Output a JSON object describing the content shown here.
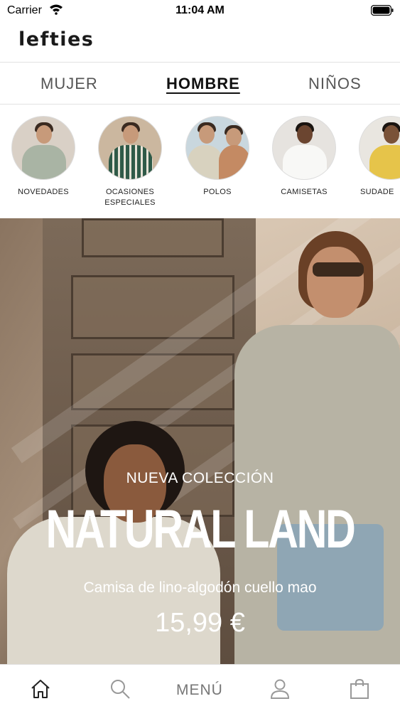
{
  "status_bar": {
    "carrier": "Carrier",
    "time": "11:04 AM"
  },
  "header": {
    "logo": "lefties"
  },
  "tabs": [
    {
      "label": "MUJER",
      "active": false
    },
    {
      "label": "HOMBRE",
      "active": true
    },
    {
      "label": "NIÑOS",
      "active": false
    }
  ],
  "categories": [
    {
      "label": "NOVEDADES",
      "shirt_color": "#a9b4a4"
    },
    {
      "label": "OCASIONES ESPECIALES",
      "shirt_color": "#2f5a48"
    },
    {
      "label": "POLOS",
      "shirt_color": "#d8d2bf"
    },
    {
      "label": "CAMISETAS",
      "shirt_color": "#f2f1ee"
    },
    {
      "label": "SUDADE",
      "shirt_color": "#e6c44a"
    }
  ],
  "hero": {
    "overline": "NUEVA COLECCIÓN",
    "title": "NATURAL LAND",
    "subtitle": "Camisa de lino-algodón cuello mao",
    "price": "15,99 €"
  },
  "bottom_nav": {
    "home_icon": "home-icon",
    "search_icon": "search-icon",
    "menu_label": "MENÚ",
    "profile_icon": "user-icon",
    "bag_icon": "shopping-bag-icon"
  }
}
